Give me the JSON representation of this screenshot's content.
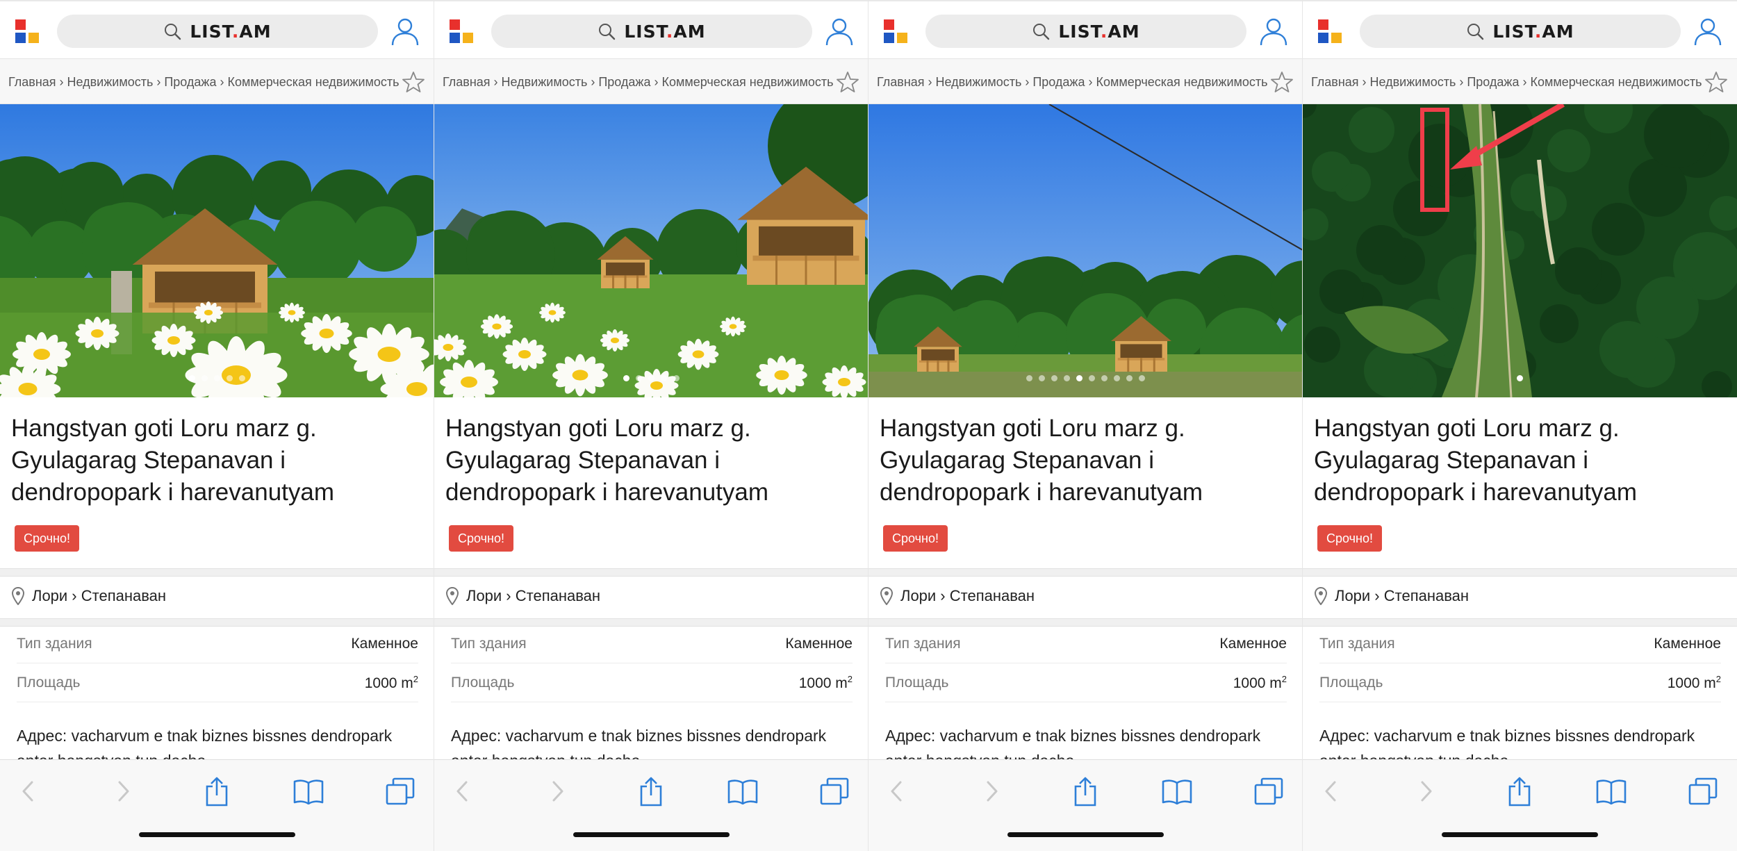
{
  "brand": {
    "text_before": "LIST",
    "dot": ".",
    "text_after": "AM"
  },
  "colors": {
    "accent_blue": "#2e7fd8",
    "urgent_red": "#e24b40",
    "logo_red": "#e8302c",
    "logo_blue": "#1f57c3",
    "logo_yellow": "#f5b21b"
  },
  "breadcrumb": "Главная › Недвижимость › Продажа › Коммерческая недвижимость",
  "listing": {
    "title": "Hangstyan goti Loru marz g. Gyulagarag Stepanavan i dendropopark i harevanutyam",
    "badge": "Срочно!",
    "location": "Лори › Степанаван",
    "attributes": [
      {
        "label": "Тип здания",
        "value": "Каменное"
      },
      {
        "label": "Площадь",
        "value": "1000 m",
        "sup": "2"
      }
    ],
    "description": "Адрес: vacharvum e tnak biznes bissnes dendropark\nantar hangstyan tun dacha"
  },
  "icons": {
    "search": "search-icon",
    "user": "user-icon",
    "star": "star-icon",
    "pin": "location-pin-icon",
    "back": "chevron-left-icon",
    "forward": "chevron-right-icon",
    "share": "share-icon",
    "bookmarks": "book-icon",
    "tabs": "tabs-icon"
  },
  "panels": [
    {
      "scene": "cabin-daisies",
      "dots": 5,
      "active_dot": 0
    },
    {
      "scene": "meadow-cabins",
      "dots": 5,
      "active_dot": 0
    },
    {
      "scene": "two-cabins-forest",
      "dots": 10,
      "active_dot": 4
    },
    {
      "scene": "satellite-map",
      "dots": 1,
      "active_dot": 0
    }
  ]
}
